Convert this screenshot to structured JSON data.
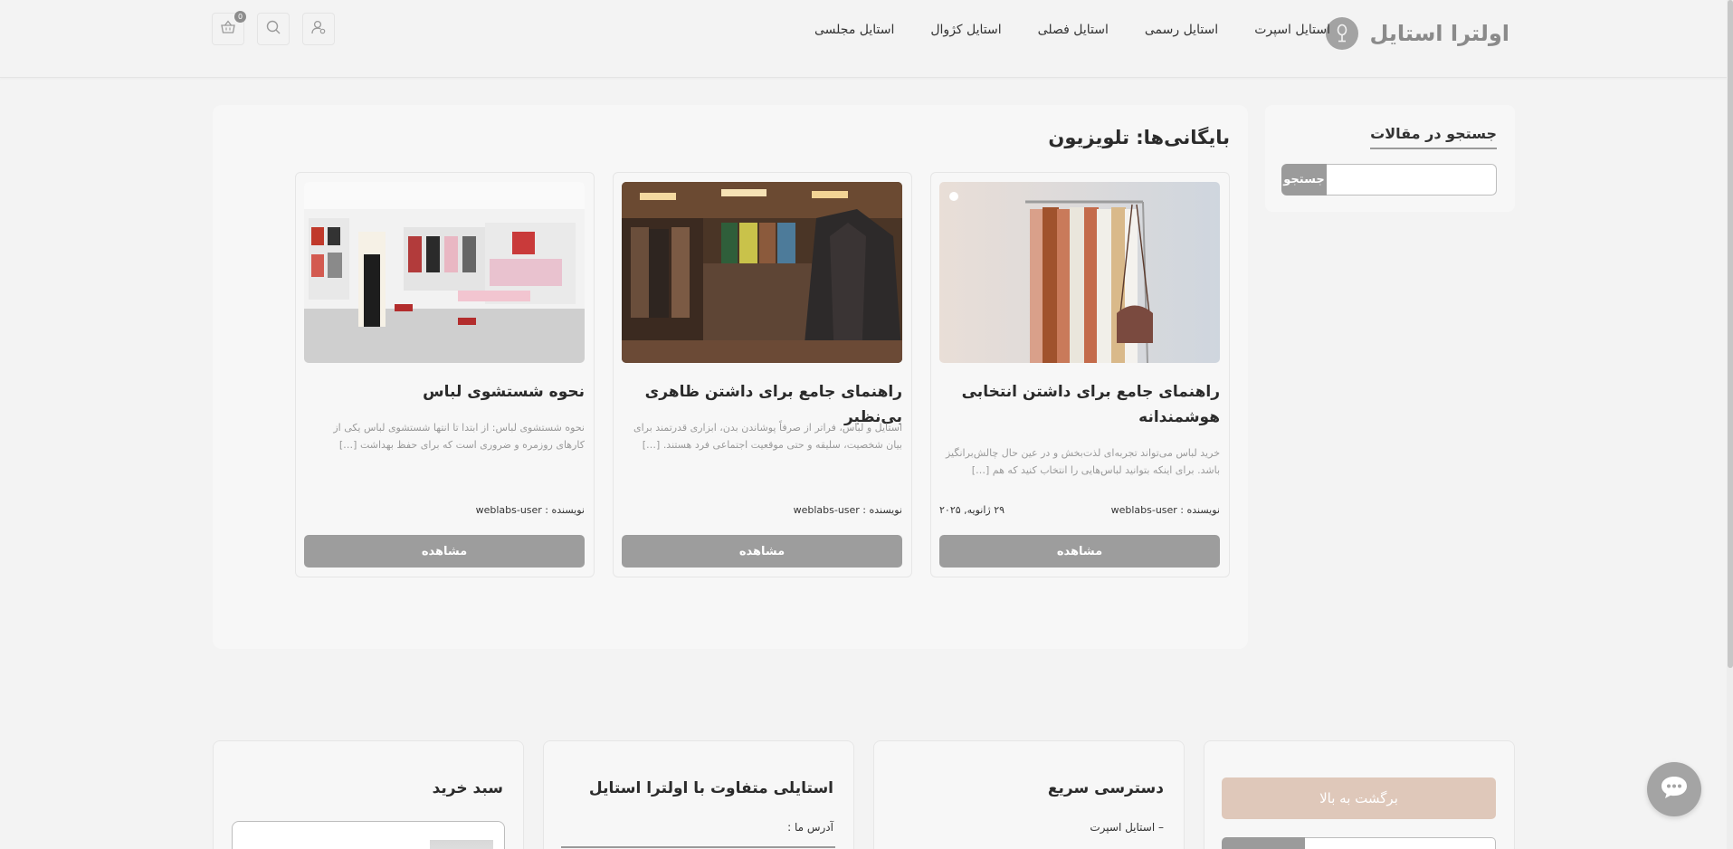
{
  "header": {
    "brand_name": "اولترا استایل",
    "nav": [
      "استایل اسپرت",
      "استایل رسمی",
      "استایل فصلی",
      "استایل کژوال",
      "استایل مجلسی"
    ],
    "cart_count": "0"
  },
  "sidebar": {
    "title": "جستجو در مقالات",
    "search_placeholder": "",
    "search_button": "جستجو"
  },
  "main": {
    "title": "بایگانی‌ها: تلویزیون",
    "cards": [
      {
        "title": "راهنمای جامع برای داشتن انتخابی هوشمندانه",
        "excerpt": "خرید لباس می‌تواند تجربه‌ای لذت‌بخش و در عین حال چالش‌برانگیز باشد. برای اینکه بتوانید لباس‌هایی را انتخاب کنید که هم […]",
        "author": "نویسنده : weblabs-user",
        "date": "۲۹ ژانویه, ۲۰۲۵",
        "button": "مشاهده"
      },
      {
        "title": "راهنمای جامع برای داشتن ظاهری بی‌نظیر",
        "excerpt": "استایل و لباس، فراتر از صرفاً پوشاندن بدن، ابزاری قدرتمند برای بیان شخصیت، سلیقه و حتی موقعیت اجتماعی فرد هستند. […]",
        "author": "نویسنده : weblabs-user",
        "date": "",
        "button": "مشاهده"
      },
      {
        "title": "نحوه شستشوی لباس",
        "excerpt": "نحوه شستشوی لباس: از ابتدا تا انتها شستشوی لباس یکی از کارهای روزمره و ضروری است که برای حفظ بهداشت […]",
        "author": "نویسنده : weblabs-user",
        "date": "",
        "button": "مشاهده"
      }
    ]
  },
  "footer": {
    "back_to_top": "برگشت به بالا",
    "quick_access_title": "دسترسی سریع",
    "quick_access_first": "–  استایل اسپرت",
    "about_title": "استایلی متفاوت با اولترا استایل",
    "address_label": "آدرس ما :",
    "cart_title": "سبد خرید"
  },
  "colors": {
    "accent_button": "#9d9d9d",
    "back_to_top": "#dfc8ba",
    "brand_text": "#8a8a8a"
  }
}
